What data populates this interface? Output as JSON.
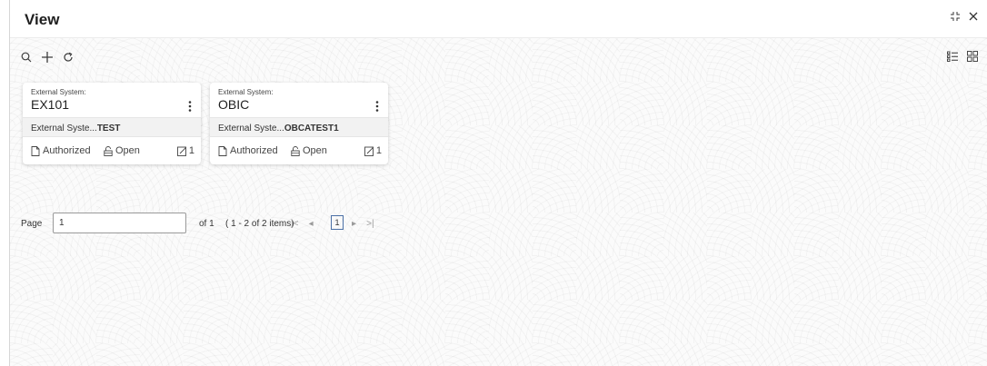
{
  "window": {
    "title": "View"
  },
  "cards": [
    {
      "label": "External System:",
      "value": "EX101",
      "detail_prefix": "External Syste...",
      "detail_value": "TEST",
      "status": "Authorized",
      "lock": "Open",
      "count": "1"
    },
    {
      "label": "External System:",
      "value": "OBIC",
      "detail_prefix": "External Syste...",
      "detail_value": "OBCATEST1",
      "status": "Authorized",
      "lock": "Open",
      "count": "1"
    }
  ],
  "pagination": {
    "page_label": "Page",
    "page_value": "1",
    "of_label": "of 1",
    "items_label": "( 1 - 2 of 2 items)",
    "current_page": "1"
  },
  "colors": {
    "accent": "#4a6fa5",
    "toolbar_icon": "#3c3c3c"
  }
}
